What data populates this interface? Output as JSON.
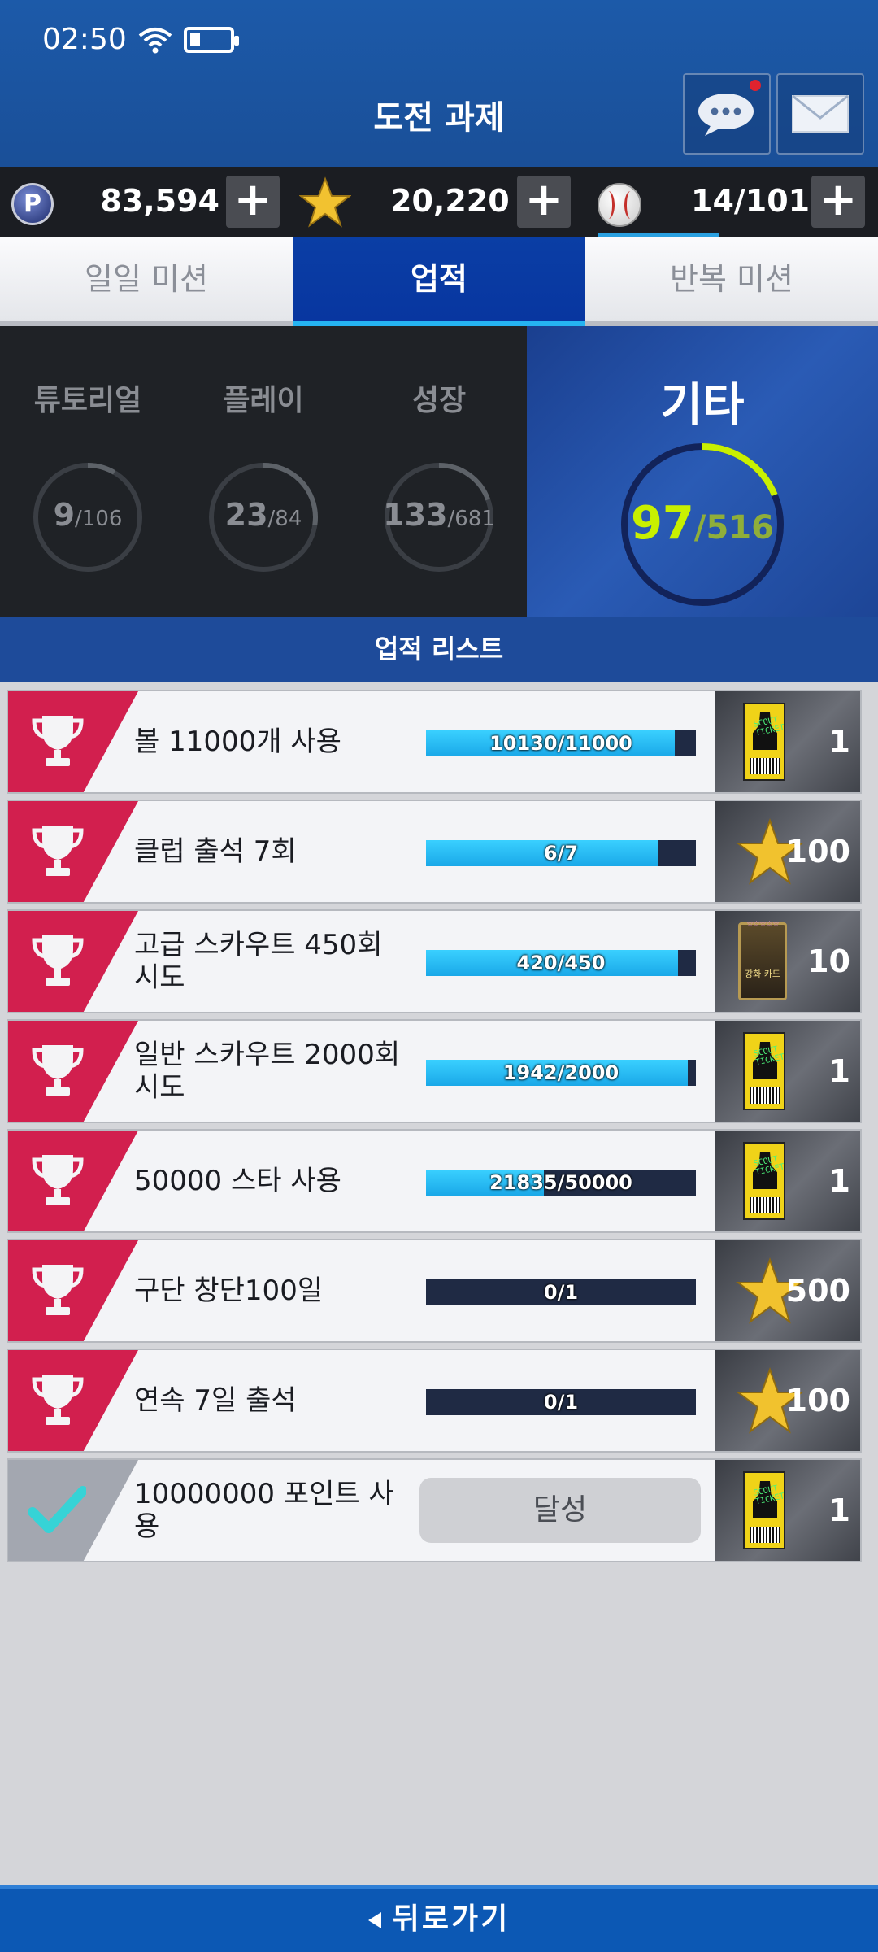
{
  "status": {
    "time": "02:50"
  },
  "header": {
    "title": "도전 과제"
  },
  "currency": {
    "points": "83,594",
    "stars": "20,220",
    "balls": "14/101",
    "points_icon_letter": "P",
    "plus": "+"
  },
  "tabs": [
    {
      "label": "일일 미션",
      "active": false
    },
    {
      "label": "업적",
      "active": true
    },
    {
      "label": "반복 미션",
      "active": false
    }
  ],
  "categories": [
    {
      "label": "튜토리얼",
      "value": "9",
      "total": "/106",
      "progress": 0.085
    },
    {
      "label": "플레이",
      "value": "23",
      "total": "/84",
      "progress": 0.274
    },
    {
      "label": "성장",
      "value": "133",
      "total": "/681",
      "progress": 0.195
    }
  ],
  "featured": {
    "label": "기타",
    "value": "97",
    "total": "/516",
    "progress": 0.188
  },
  "list_title": "업적 리스트",
  "achievements": [
    {
      "title": "볼 11000개 사용",
      "progress_label": "10130/11000",
      "progress": 0.921,
      "reward_type": "ticket",
      "reward": "1",
      "done": false
    },
    {
      "title": "클럽 출석 7회",
      "progress_label": "6/7",
      "progress": 0.857,
      "reward_type": "star",
      "reward": "100",
      "done": false
    },
    {
      "title": "고급 스카우트 450회 시도",
      "progress_label": "420/450",
      "progress": 0.933,
      "reward_type": "card",
      "reward": "10",
      "done": false
    },
    {
      "title": "일반 스카우트 2000회 시도",
      "progress_label": "1942/2000",
      "progress": 0.971,
      "reward_type": "ticket",
      "reward": "1",
      "done": false
    },
    {
      "title": "50000 스타 사용",
      "progress_label": "21835/50000",
      "progress": 0.437,
      "reward_type": "ticket",
      "reward": "1",
      "done": false
    },
    {
      "title": "구단 창단100일",
      "progress_label": "0/1",
      "progress": 0,
      "reward_type": "star",
      "reward": "500",
      "done": false
    },
    {
      "title": "연속 7일 출석",
      "progress_label": "0/1",
      "progress": 0,
      "reward_type": "star",
      "reward": "100",
      "done": false
    },
    {
      "title": "10000000 포인트 사용",
      "done_label": "달성",
      "reward_type": "ticket",
      "reward": "1",
      "done": true
    }
  ],
  "reward_text": {
    "ticket": "SCOUT TICKET",
    "card": "강화 카드",
    "card_stars": "☆☆☆☆☆"
  },
  "back_label": "뒤로가기",
  "colors": {
    "accent": "#0a3ea5",
    "tab_underline": "#25b4f2",
    "badge": "#d21f4e",
    "featured_ring": "#c8f000"
  }
}
